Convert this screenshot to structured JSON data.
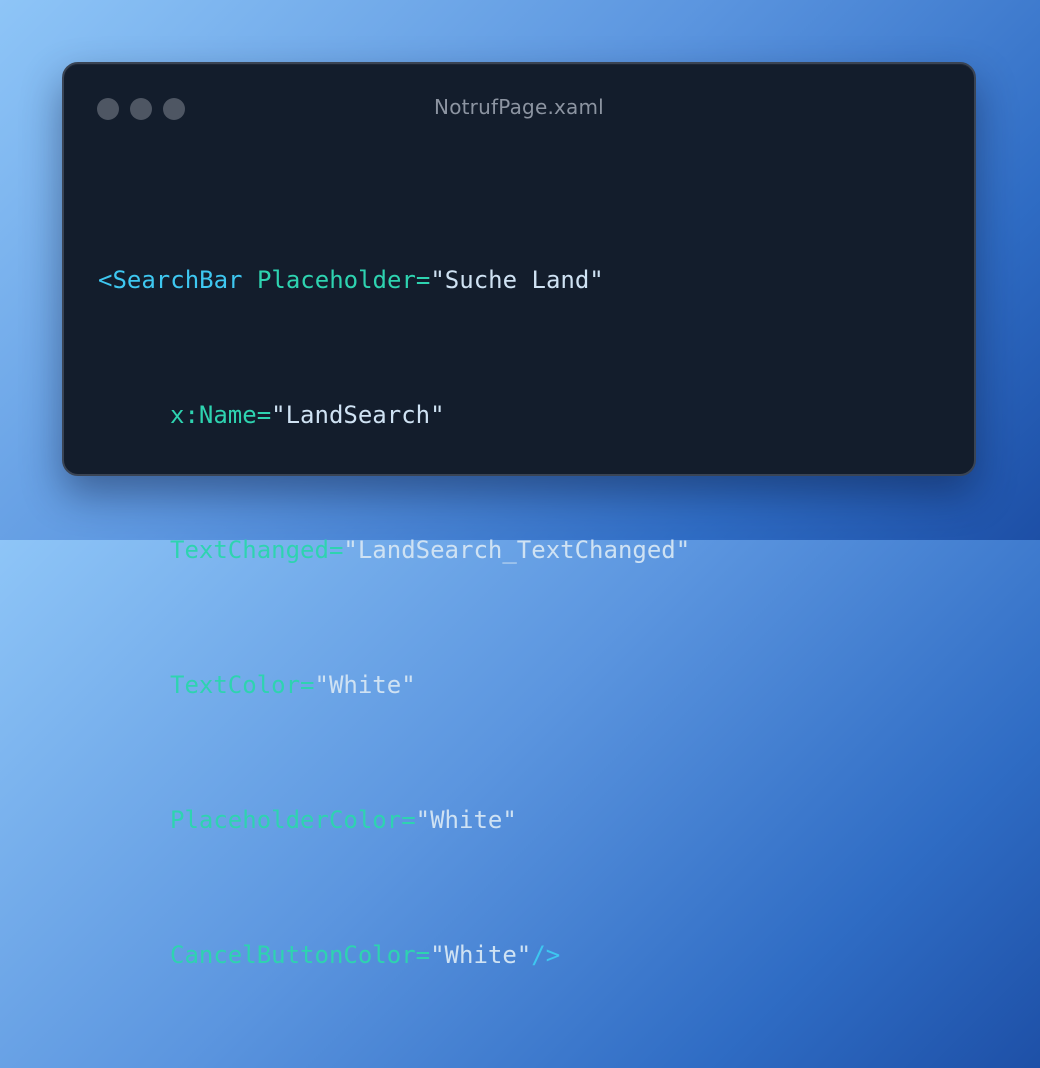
{
  "window": {
    "title": "NotrufPage.xaml",
    "controls": [
      "close-dot",
      "minimize-dot",
      "maximize-dot"
    ]
  },
  "colors": {
    "tag": "#3ec7f0",
    "attribute": "#2ed3b0",
    "string": "#cfe2f3",
    "window_bg": "#131d2c"
  },
  "code": {
    "line1": {
      "tag_open": "<SearchBar",
      "attr": "Placeholder",
      "eq": "=",
      "value": "\"Suche Land\""
    },
    "line2": {
      "attr": "x:Name",
      "eq": "=",
      "value": "\"LandSearch\""
    },
    "line3": {
      "attr": "TextChanged",
      "eq": "=",
      "value": "\"LandSearch_TextChanged\""
    },
    "line4": {
      "attr": "TextColor",
      "eq": "=",
      "value": "\"White\""
    },
    "line5": {
      "attr": "PlaceholderColor",
      "eq": "=",
      "value": "\"White\""
    },
    "line6": {
      "attr": "CancelButtonColor",
      "eq": "=",
      "value": "\"White\"",
      "tag_close": "/>"
    }
  }
}
